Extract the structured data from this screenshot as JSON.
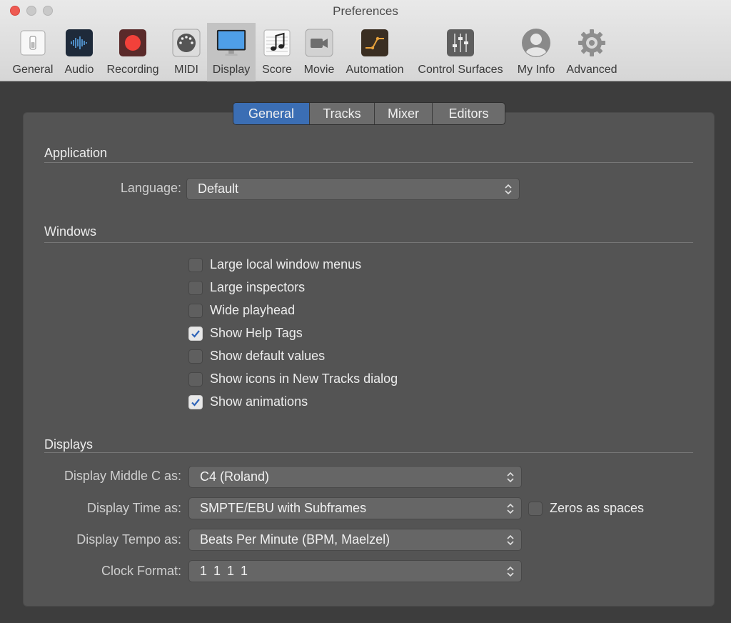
{
  "window": {
    "title": "Preferences"
  },
  "toolbar": {
    "items": [
      {
        "label": "General",
        "icon": "general-switch-icon"
      },
      {
        "label": "Audio",
        "icon": "audio-waveform-icon"
      },
      {
        "label": "Recording",
        "icon": "record-icon"
      },
      {
        "label": "MIDI",
        "icon": "midi-connector-icon"
      },
      {
        "label": "Display",
        "icon": "display-monitor-icon"
      },
      {
        "label": "Score",
        "icon": "score-note-icon"
      },
      {
        "label": "Movie",
        "icon": "movie-camera-icon"
      },
      {
        "label": "Automation",
        "icon": "automation-curve-icon"
      },
      {
        "label": "Control Surfaces",
        "icon": "control-faders-icon"
      },
      {
        "label": "My Info",
        "icon": "user-silhouette-icon"
      },
      {
        "label": "Advanced",
        "icon": "gear-icon"
      }
    ],
    "selected": "Display"
  },
  "tabs": [
    "General",
    "Tracks",
    "Mixer",
    "Editors"
  ],
  "active_tab": "General",
  "application": {
    "title": "Application",
    "language_label": "Language:",
    "language_value": "Default"
  },
  "windows": {
    "title": "Windows",
    "options": [
      {
        "label": "Large local window menus",
        "checked": false
      },
      {
        "label": "Large inspectors",
        "checked": false
      },
      {
        "label": "Wide playhead",
        "checked": false
      },
      {
        "label": "Show Help Tags",
        "checked": true
      },
      {
        "label": "Show default values",
        "checked": false
      },
      {
        "label": "Show icons in New Tracks dialog",
        "checked": false
      },
      {
        "label": "Show animations",
        "checked": true
      }
    ]
  },
  "displays": {
    "title": "Displays",
    "middle_c_label": "Display Middle C as:",
    "middle_c_value": "C4 (Roland)",
    "time_label": "Display Time as:",
    "time_value": "SMPTE/EBU with Subframes",
    "zeros_label": "Zeros as spaces",
    "zeros_checked": false,
    "tempo_label": "Display Tempo as:",
    "tempo_value": "Beats Per Minute (BPM, Maelzel)",
    "clock_label": "Clock Format:",
    "clock_value": "1 1 1 1"
  },
  "colors": {
    "accent": "#3b6eb4",
    "panel": "#545454",
    "background": "#3d3d3d"
  }
}
